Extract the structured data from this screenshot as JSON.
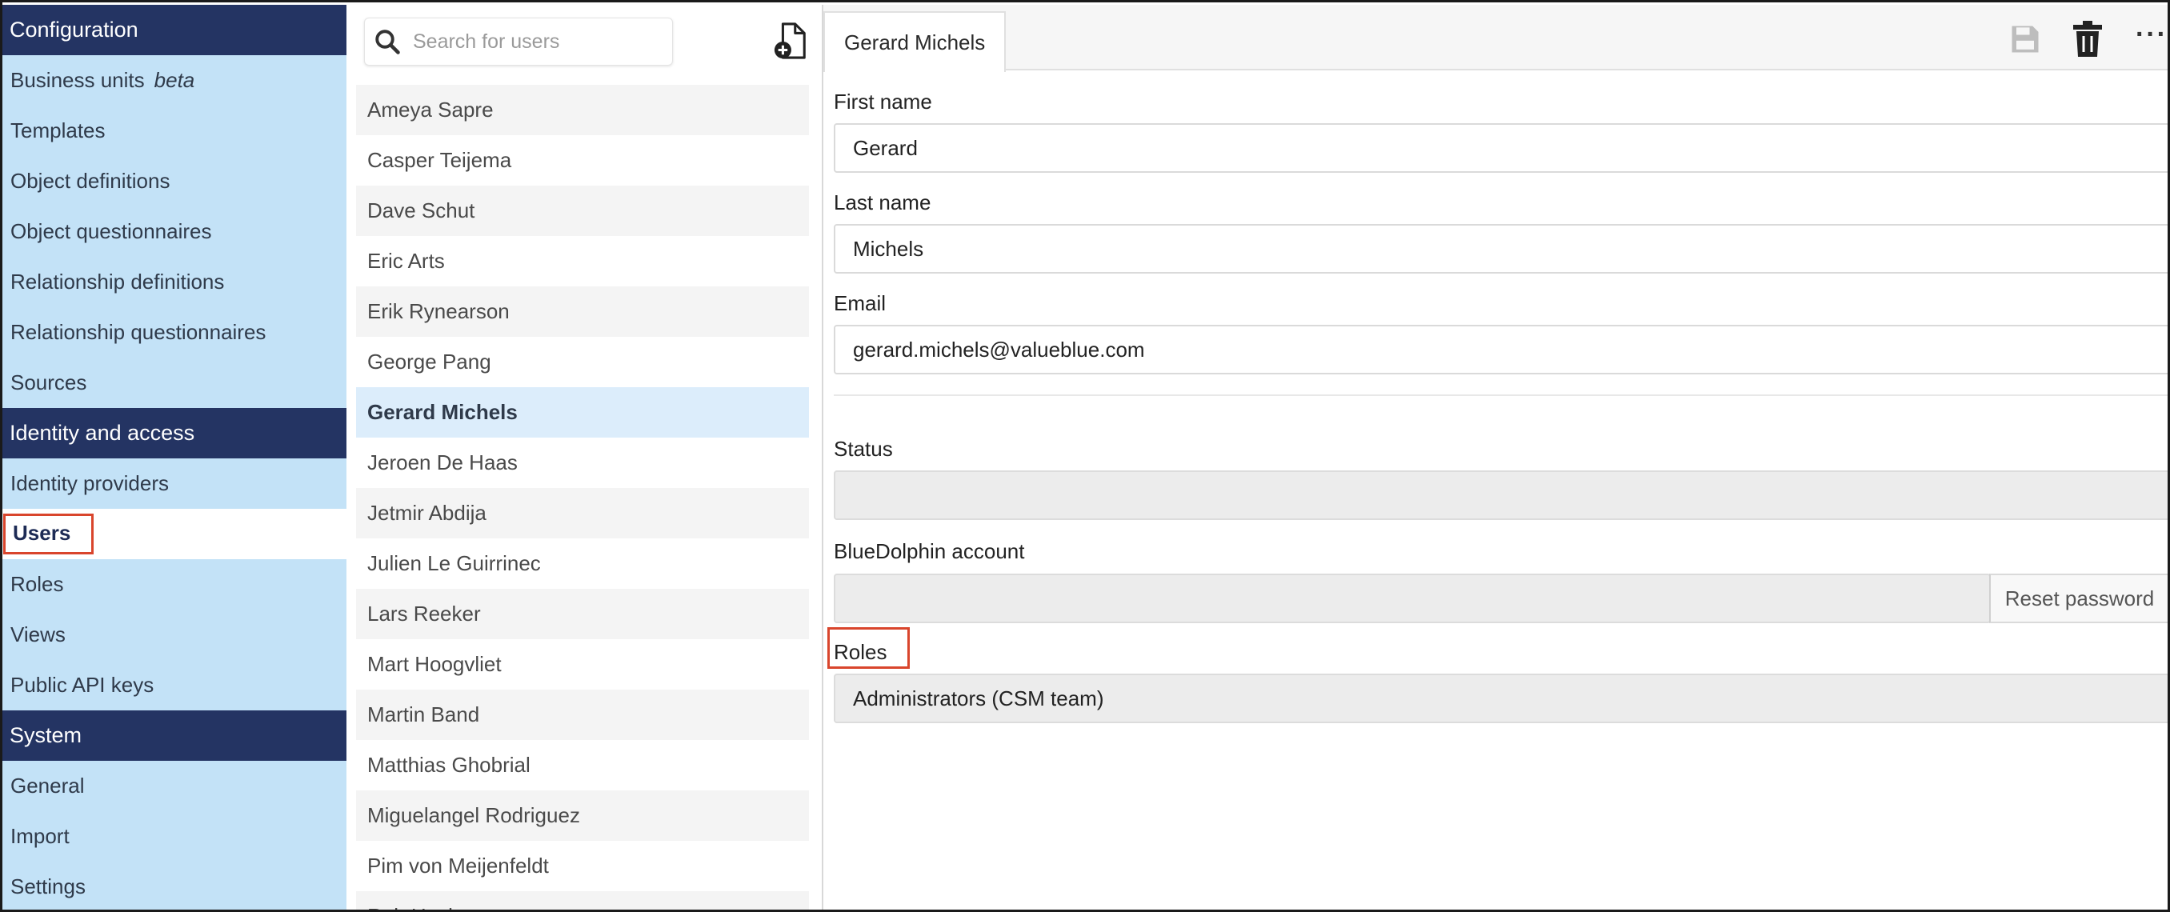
{
  "sidebar": {
    "sections": [
      {
        "title": "Configuration",
        "items": [
          {
            "label": "Business units",
            "extra": "beta"
          },
          {
            "label": "Templates"
          },
          {
            "label": "Object definitions"
          },
          {
            "label": "Object questionnaires"
          },
          {
            "label": "Relationship definitions"
          },
          {
            "label": "Relationship questionnaires"
          },
          {
            "label": "Sources"
          }
        ]
      },
      {
        "title": "Identity and access",
        "items": [
          {
            "label": "Identity providers"
          },
          {
            "label": "Users",
            "active": true
          },
          {
            "label": "Roles"
          },
          {
            "label": "Views"
          },
          {
            "label": "Public API keys"
          }
        ]
      },
      {
        "title": "System",
        "items": [
          {
            "label": "General"
          },
          {
            "label": "Import"
          },
          {
            "label": "Settings"
          }
        ]
      }
    ]
  },
  "users_panel": {
    "search_placeholder": "Search for users",
    "users": [
      "Ameya Sapre",
      "Casper Teijema",
      "Dave Schut",
      "Eric Arts",
      "Erik Rynearson",
      "George Pang",
      "Gerard Michels",
      "Jeroen De Haas",
      "Jetmir Abdija",
      "Julien Le Guirrinec",
      "Lars Reeker",
      "Mart Hoogvliet",
      "Martin Band",
      "Matthias Ghobrial",
      "Miguelangel Rodriguez",
      "Pim von Meijenfeldt",
      "Rob Heslop"
    ],
    "selected_user": "Gerard Michels"
  },
  "detail": {
    "tab_title": "Gerard Michels",
    "more_label": "···",
    "fields": {
      "first_name": {
        "label": "First name",
        "value": "Gerard"
      },
      "last_name": {
        "label": "Last name",
        "value": "Michels"
      },
      "email": {
        "label": "Email",
        "value": "gerard.michels@valueblue.com"
      },
      "status": {
        "label": "Status",
        "value": ""
      },
      "account": {
        "label": "BlueDolphin account",
        "value": "",
        "reset_label": "Reset password"
      },
      "roles": {
        "label": "Roles",
        "value": "Administrators (CSM team)"
      }
    }
  },
  "colors": {
    "sidebar_bg": "#c3e2f7",
    "sidebar_section_bg": "#243463",
    "highlight_border": "#d9452c",
    "selected_row_bg": "#dcedfb"
  }
}
